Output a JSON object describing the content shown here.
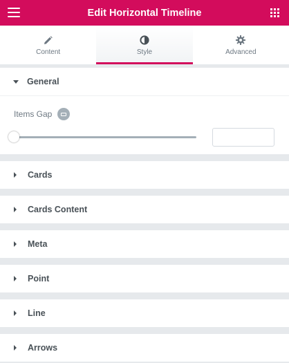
{
  "header": {
    "title": "Edit Horizontal Timeline",
    "menu_icon": "hamburger-icon",
    "widgets_icon": "grid-icon"
  },
  "tabs": [
    {
      "label": "Content",
      "icon": "pencil-icon",
      "active": false
    },
    {
      "label": "Style",
      "icon": "contrast-icon",
      "active": true
    },
    {
      "label": "Advanced",
      "icon": "gear-icon",
      "active": false
    }
  ],
  "sections": {
    "general": {
      "title": "General",
      "items_gap": {
        "label": "Items Gap",
        "value": "",
        "slider_value": 0,
        "device_icon": "desktop-icon"
      }
    },
    "cards": "Cards",
    "cards_content": "Cards Content",
    "meta": "Meta",
    "point": "Point",
    "line": "Line",
    "arrows": "Arrows"
  },
  "colors": {
    "accent": "#d30c5c",
    "panel_bg": "#e6e9ec",
    "text": "#495157",
    "muted": "#6d7882"
  }
}
